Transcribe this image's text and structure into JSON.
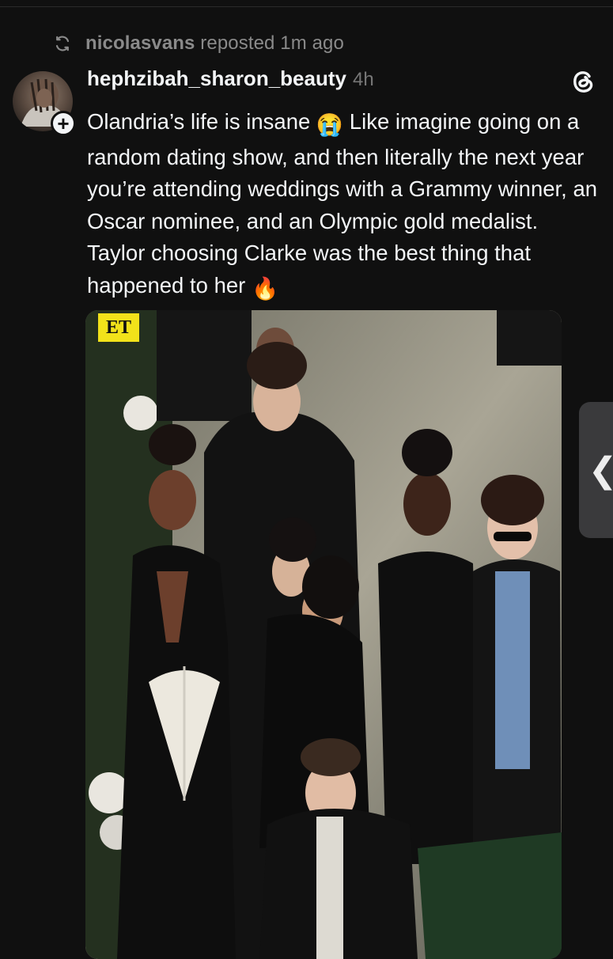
{
  "repost": {
    "user": "nicolasvans",
    "action": "reposted",
    "time": "1m ago",
    "icon": "repost-icon"
  },
  "post": {
    "username": "hephzibah_sharon_beauty",
    "time": "4h",
    "follow_icon": "plus-icon",
    "brand_icon": "threads-logo-icon",
    "text_part1": "Olandria’s life is insane",
    "emoji1": "😭",
    "text_part2": " Like imagine going on a random dating show, and then literally the next year you’re attending weddings with a Grammy winner, an Oscar nominee, and an Olympic gold medalist. Taylor choosing Clarke was the best thing that happened to her",
    "emoji2": "🔥"
  },
  "media": {
    "watermark": "ET"
  },
  "side_handle": {
    "glyph": "❮"
  }
}
